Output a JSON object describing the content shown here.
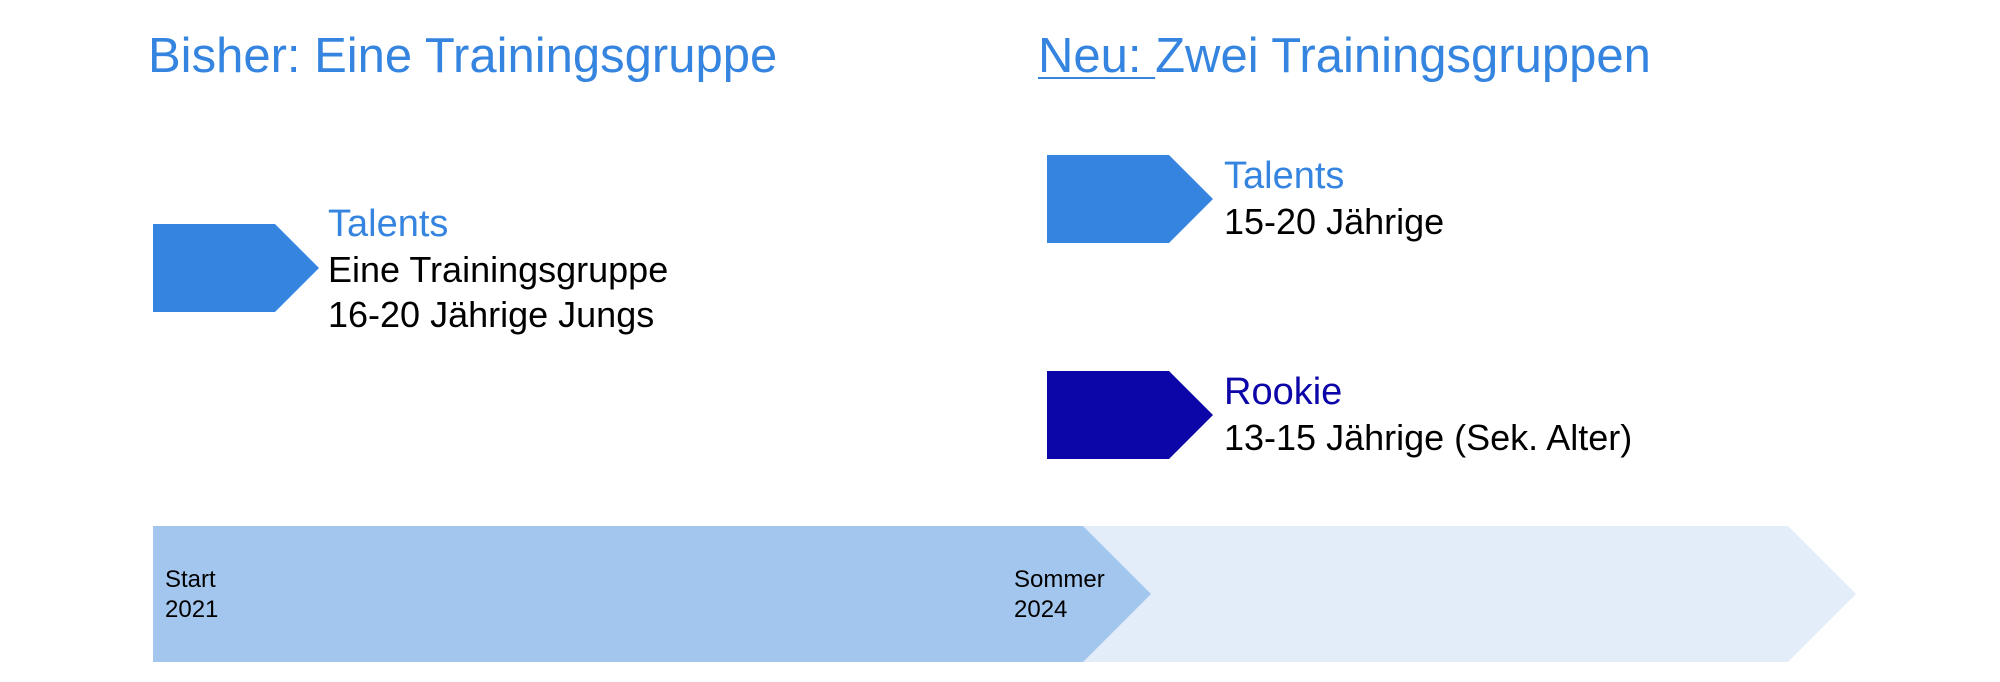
{
  "colors": {
    "accent": "#3585E0",
    "dark": "#0C06A8",
    "timeline_past": "#A3C6EE",
    "timeline_future": "#E3EDF9",
    "text": "#000000"
  },
  "left": {
    "heading": "Bisher: Eine Trainingsgruppe",
    "group": {
      "title": "Talents",
      "lines": [
        "Eine Trainingsgruppe",
        "16-20 Jährige Jungs"
      ]
    }
  },
  "right": {
    "heading_underlined": "Neu: ",
    "heading_rest": "Zwei Trainingsgruppen",
    "groups": [
      {
        "title": "Talents",
        "lines": [
          "15-20 Jährige"
        ]
      },
      {
        "title": "Rookie",
        "lines": [
          "13-15 Jährige (Sek. Alter)"
        ]
      }
    ]
  },
  "timeline": {
    "start_label": [
      "Start",
      "2021"
    ],
    "mid_label": [
      "Sommer",
      "2024"
    ]
  }
}
